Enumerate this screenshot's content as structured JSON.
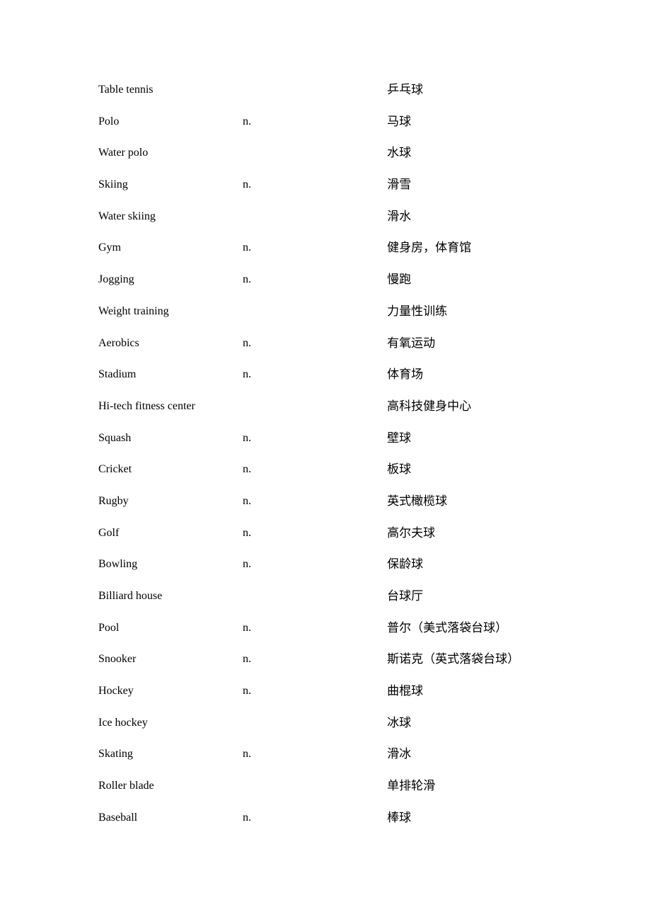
{
  "document": {
    "entries": [
      {
        "term": "Table tennis",
        "pos": "",
        "meaning": "乒乓球"
      },
      {
        "term": "Polo",
        "pos": "n.",
        "meaning": "马球"
      },
      {
        "term": "Water polo",
        "pos": "",
        "meaning": "水球"
      },
      {
        "term": "Skiing",
        "pos": "n.",
        "meaning": "滑雪"
      },
      {
        "term": "Water skiing",
        "pos": "",
        "meaning": "滑水"
      },
      {
        "term": "Gym",
        "pos": "n.",
        "meaning": "健身房，体育馆"
      },
      {
        "term": "Jogging",
        "pos": "n.",
        "meaning": "慢跑"
      },
      {
        "term": "Weight training",
        "pos": "",
        "meaning": "力量性训练"
      },
      {
        "term": "Aerobics",
        "pos": "n.",
        "meaning": "有氧运动"
      },
      {
        "term": "Stadium",
        "pos": "n.",
        "meaning": "体育场"
      },
      {
        "term": "Hi-tech fitness center",
        "pos": "",
        "meaning": "高科技健身中心"
      },
      {
        "term": "Squash",
        "pos": "n.",
        "meaning": "壁球"
      },
      {
        "term": "Cricket",
        "pos": "n.",
        "meaning": "板球"
      },
      {
        "term": "Rugby",
        "pos": "n.",
        "meaning": "英式橄榄球"
      },
      {
        "term": "Golf",
        "pos": "n.",
        "meaning": "高尔夫球"
      },
      {
        "term": "Bowling",
        "pos": "n.",
        "meaning": "保龄球"
      },
      {
        "term": "Billiard house",
        "pos": "",
        "meaning": "台球厅"
      },
      {
        "term": "Pool",
        "pos": "n.",
        "meaning": "普尔（美式落袋台球）"
      },
      {
        "term": "Snooker",
        "pos": "n.",
        "meaning": "斯诺克（英式落袋台球）"
      },
      {
        "term": "Hockey",
        "pos": "n.",
        "meaning": "曲棍球"
      },
      {
        "term": "Ice hockey",
        "pos": "",
        "meaning": "冰球"
      },
      {
        "term": "Skating",
        "pos": "n.",
        "meaning": "滑冰"
      },
      {
        "term": "Roller blade",
        "pos": "",
        "meaning": "单排轮滑"
      },
      {
        "term": "Baseball",
        "pos": "n.",
        "meaning": "棒球"
      }
    ]
  }
}
